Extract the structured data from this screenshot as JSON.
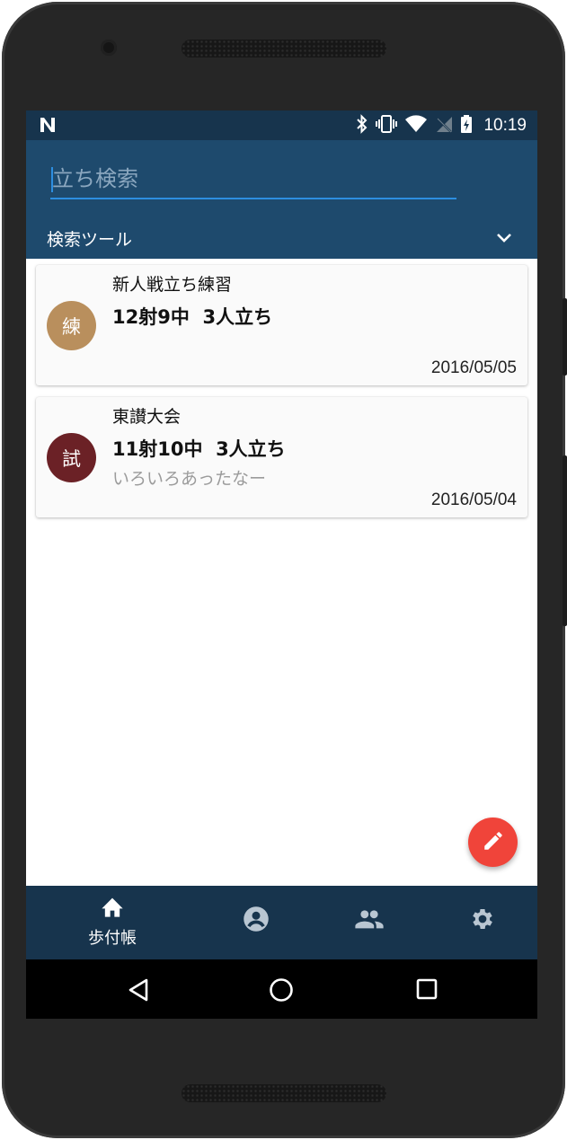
{
  "statusbar": {
    "time": "10:19"
  },
  "search": {
    "placeholder": "立ち検索",
    "value": ""
  },
  "tools": {
    "label": "検索ツール"
  },
  "records": [
    {
      "avatar_text": "練",
      "avatar_color": "#b98f5d",
      "title": "新人戦立ち練習",
      "score": "12射9中  3人立ち",
      "note": "",
      "date": "2016/05/05"
    },
    {
      "avatar_text": "試",
      "avatar_color": "#6b2126",
      "title": "東讃大会",
      "score": "11射10中  3人立ち",
      "note": "いろいろあったなー",
      "date": "2016/05/04"
    }
  ],
  "fab": {
    "icon": "pencil-icon",
    "color": "#f0443a"
  },
  "bottom_nav": {
    "items": [
      {
        "icon": "home-icon",
        "label": "歩付帳",
        "active": true
      },
      {
        "icon": "account-circle-icon",
        "label": ""
      },
      {
        "icon": "group-icon",
        "label": ""
      },
      {
        "icon": "settings-gear-icon",
        "label": ""
      }
    ]
  },
  "system_nav": {
    "buttons": [
      "back-icon",
      "home-circle-icon",
      "recents-square-icon"
    ]
  },
  "colors": {
    "status_bar": "#17344d",
    "app_bar": "#1e4a6d",
    "accent": "#2d8ee0"
  }
}
